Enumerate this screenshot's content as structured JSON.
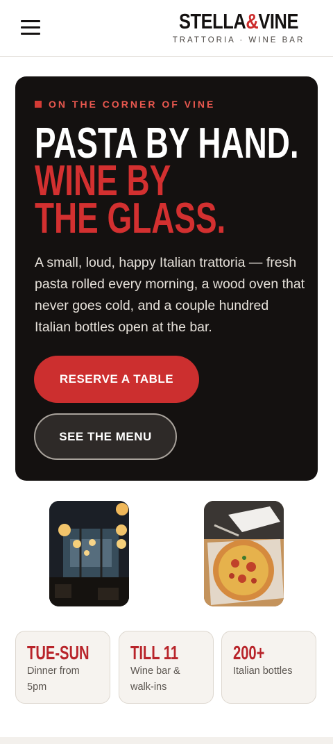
{
  "header": {
    "logo": {
      "part1": "STELLA",
      "amp": "&",
      "part2": "VINE"
    },
    "tagline": "TRATTORIA · WINE BAR",
    "menu_icon": "hamburger-menu-icon"
  },
  "hero": {
    "eyebrow": "ON THE CORNER OF VINE",
    "headline": {
      "line1": "PASTA BY HAND.",
      "line2": "WINE BY",
      "line3": "THE GLASS."
    },
    "copy": "A small, loud, happy Italian trattoria — fresh pasta rolled every morning, a wood oven that never goes cold, and a couple hundred Italian bottles open at the bar.",
    "primary_cta": "RESERVE A TABLE",
    "secondary_cta": "SEE THE MENU"
  },
  "photos": [
    {
      "name": "restaurant-interior-photo"
    },
    {
      "name": "pizza-photo"
    }
  ],
  "stats": [
    {
      "value": "TUE-SUN",
      "label": "Dinner from 5pm"
    },
    {
      "value": "TILL 11",
      "label": "Wine bar & walk-ins"
    },
    {
      "value": "200+",
      "label": "Italian bottles"
    }
  ],
  "colors": {
    "accent_red": "#cc2f2f",
    "hero_bg": "#141110",
    "card_bg": "#f6f3ef"
  }
}
